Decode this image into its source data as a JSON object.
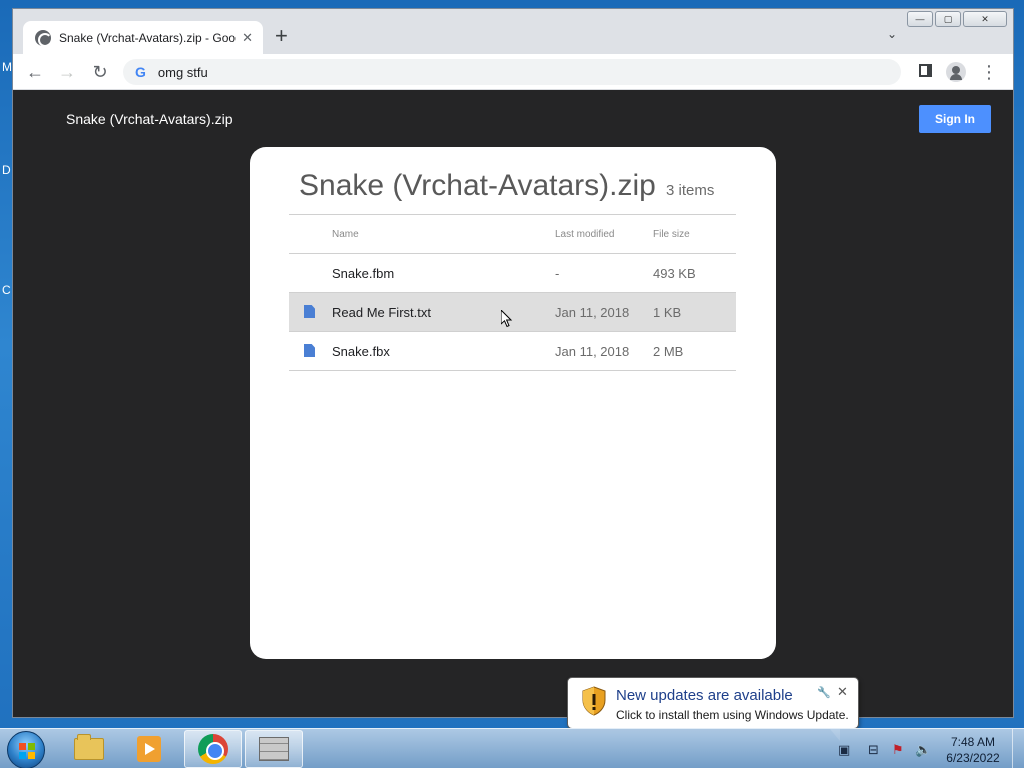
{
  "desktop": {
    "edge_letters": [
      "M",
      "D",
      "C"
    ]
  },
  "browser": {
    "tab": {
      "title": "Snake (Vrchat-Avatars).zip - Google",
      "close_icon": "close-icon"
    },
    "new_tab_label": "+",
    "tab_search_glyph": "⌄",
    "window_controls": {
      "minimize": "—",
      "maximize": "▢",
      "close": "✕"
    },
    "nav": {
      "back": "←",
      "forward": "→",
      "reload": "↻"
    },
    "omnibox": {
      "logo": "G",
      "text": "omg stfu"
    },
    "menu_glyph": "⋮"
  },
  "page": {
    "header_title": "Snake (Vrchat-Avatars).zip",
    "signin_label": "Sign In",
    "card": {
      "title": "Snake (Vrchat-Avatars).zip",
      "count": "3 items",
      "columns": {
        "name": "Name",
        "modified": "Last modified",
        "size": "File size"
      },
      "rows": [
        {
          "name": "Snake.fbm",
          "modified": "-",
          "size": "493 KB",
          "icon": "none"
        },
        {
          "name": "Read Me First.txt",
          "modified": "Jan 11, 2018",
          "size": "1 KB",
          "icon": "file-icon"
        },
        {
          "name": "Snake.fbx",
          "modified": "Jan 11, 2018",
          "size": "2 MB",
          "icon": "file-icon"
        }
      ]
    }
  },
  "notification": {
    "title": "New updates are available",
    "body": "Click to install them using Windows Update."
  },
  "taskbar": {
    "clock_time": "7:48 AM",
    "clock_date": "6/23/2022"
  },
  "colors": {
    "page_bg": "#252526",
    "signin": "#4d90fe",
    "file_icon": "#4a7fd4",
    "notification_title": "#1e3f8a"
  }
}
